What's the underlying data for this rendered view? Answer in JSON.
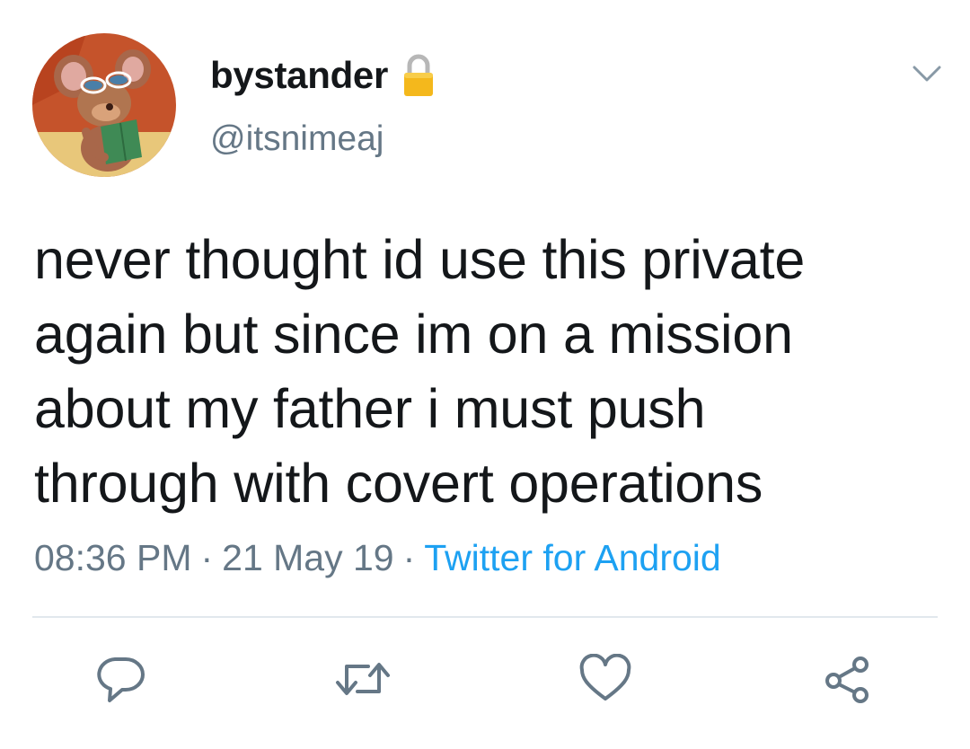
{
  "user": {
    "display_name": "bystander",
    "handle": "@itsnimeaj",
    "protected_icon": "lock-icon",
    "avatar": "cartoon-mouse-reading-book"
  },
  "tweet": {
    "text_lines": [
      "never thought id use this private",
      "again but since im on a mission",
      "about my father i must push",
      "through with covert operations"
    ],
    "time": "08:36 PM",
    "date": "21 May 19",
    "separator": "·",
    "source": "Twitter for Android"
  },
  "actions": {
    "reply_icon": "reply-icon",
    "retweet_icon": "retweet-icon",
    "like_icon": "heart-icon",
    "share_icon": "share-icon",
    "menu_icon": "chevron-down-icon"
  },
  "colors": {
    "text": "#14171a",
    "secondary": "#657786",
    "link": "#1da1f2",
    "divider": "#e1e8ed"
  }
}
